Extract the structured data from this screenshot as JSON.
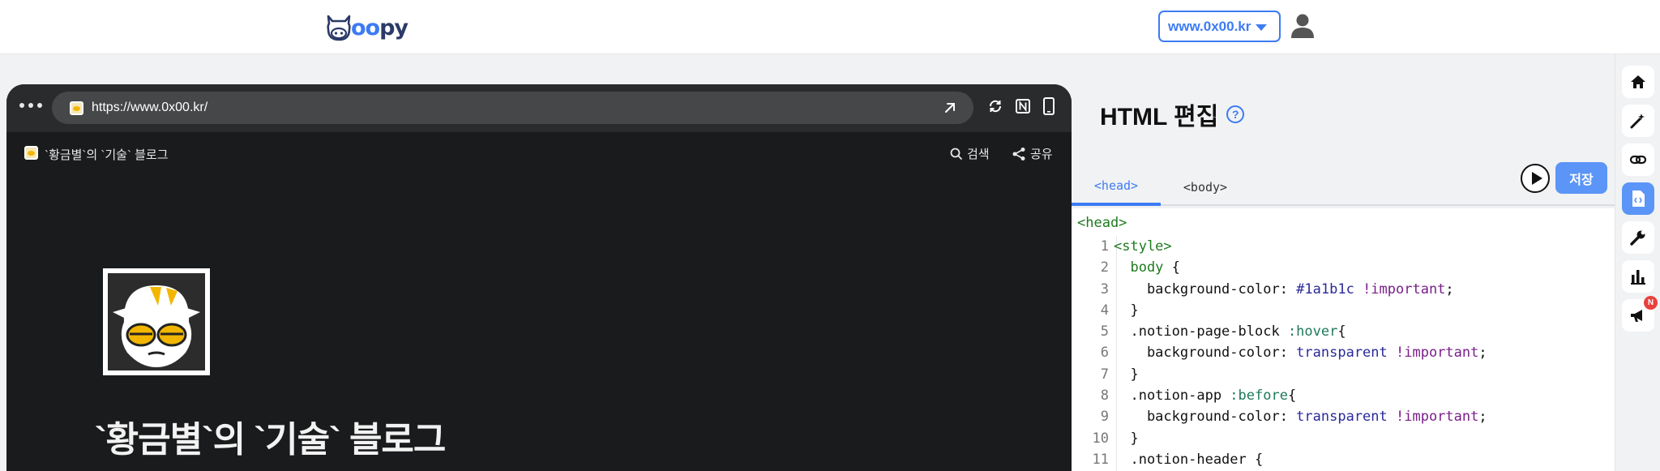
{
  "header": {
    "logo_text_a": "oo",
    "logo_text_b": "py",
    "domain_selected": "www.0x00.kr",
    "icons": {
      "logo": "cow-logo-icon",
      "caret": "caret-down-icon",
      "user": "user-icon"
    }
  },
  "preview": {
    "url": "https://www.0x00.kr/",
    "site_title": "`황금별`의 `기술` 블로그",
    "search_label": "검색",
    "share_label": "공유",
    "page_heading": "`황금별`의 `기술` 블로그",
    "icons": [
      "more-dots-icon",
      "favicon-icon",
      "open-external-icon",
      "refresh-icon",
      "notion-icon",
      "mobile-icon",
      "search-icon",
      "share-icon"
    ],
    "background_color": "#1a1b1c"
  },
  "editor": {
    "title": "HTML 편집",
    "help_label": "?",
    "tabs": [
      {
        "label": "<head>",
        "active": true
      },
      {
        "label": "<body>",
        "active": false
      }
    ],
    "save_label": "저장",
    "code_root": "<head>",
    "code_lines": [
      {
        "n": "1",
        "parts": [
          [
            "c-tag",
            "<style>"
          ]
        ]
      },
      {
        "n": "2",
        "parts": [
          [
            "c-sel",
            "  body "
          ],
          [
            "c-p",
            "{"
          ]
        ]
      },
      {
        "n": "3",
        "parts": [
          [
            "c-prop",
            "    background-color: "
          ],
          [
            "c-val",
            "#1a1b1c "
          ],
          [
            "c-kw",
            "!important"
          ],
          [
            "c-p",
            ";"
          ]
        ]
      },
      {
        "n": "4",
        "parts": [
          [
            "c-p",
            "  }"
          ]
        ]
      },
      {
        "n": "5",
        "parts": [
          [
            "c-prop",
            "  .notion-page-block "
          ],
          [
            "c-pseudo",
            ":hover"
          ],
          [
            "c-p",
            "{"
          ]
        ]
      },
      {
        "n": "6",
        "parts": [
          [
            "c-prop",
            "    background-color: "
          ],
          [
            "c-val",
            "transparent "
          ],
          [
            "c-kw",
            "!important"
          ],
          [
            "c-p",
            ";"
          ]
        ]
      },
      {
        "n": "7",
        "parts": [
          [
            "c-p",
            "  }"
          ]
        ]
      },
      {
        "n": "8",
        "parts": [
          [
            "c-prop",
            "  .notion-app "
          ],
          [
            "c-pseudo",
            ":before"
          ],
          [
            "c-p",
            "{"
          ]
        ]
      },
      {
        "n": "9",
        "parts": [
          [
            "c-prop",
            "    background-color: "
          ],
          [
            "c-val",
            "transparent "
          ],
          [
            "c-kw",
            "!important"
          ],
          [
            "c-p",
            ";"
          ]
        ]
      },
      {
        "n": "10",
        "parts": [
          [
            "c-p",
            "  }"
          ]
        ]
      },
      {
        "n": "11",
        "parts": [
          [
            "c-prop",
            "  .notion-header "
          ],
          [
            "c-p",
            "{"
          ]
        ]
      }
    ]
  },
  "rail": {
    "items": [
      "home-icon",
      "magic-wand-icon",
      "link-icon",
      "html-file-icon",
      "wrench-icon",
      "stats-icon",
      "megaphone-icon"
    ],
    "active_index": 3,
    "badge": "N"
  },
  "colors": {
    "accent": "#3d7bf3",
    "save": "#5b95f7",
    "badge": "#e8413c"
  }
}
